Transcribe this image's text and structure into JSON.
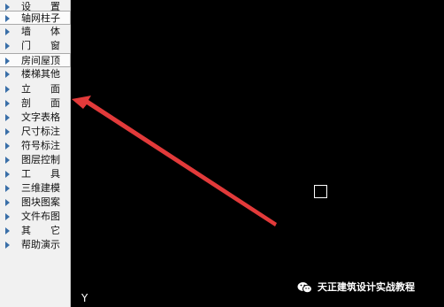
{
  "menu": {
    "items": [
      {
        "label": "设　　置",
        "name": "menu-item-settings"
      },
      {
        "label": "轴网柱子",
        "name": "menu-item-axis-grid-columns",
        "active": true
      },
      {
        "label": "墙　　体",
        "name": "menu-item-walls"
      },
      {
        "label": "门　　窗",
        "name": "menu-item-doors-windows"
      },
      {
        "label": "房间屋顶",
        "name": "menu-item-rooms-roof",
        "active": true
      },
      {
        "label": "楼梯其他",
        "name": "menu-item-stairs-other"
      },
      {
        "label": "立　　面",
        "name": "menu-item-elevation"
      },
      {
        "label": "剖　　面",
        "name": "menu-item-section"
      },
      {
        "label": "文字表格",
        "name": "menu-item-text-tables"
      },
      {
        "label": "尺寸标注",
        "name": "menu-item-dimensions"
      },
      {
        "label": "符号标注",
        "name": "menu-item-symbols"
      },
      {
        "label": "图层控制",
        "name": "menu-item-layer-control"
      },
      {
        "label": "工　　具",
        "name": "menu-item-tools"
      },
      {
        "label": "三维建模",
        "name": "menu-item-3d-modeling"
      },
      {
        "label": "图块图案",
        "name": "menu-item-blocks-patterns"
      },
      {
        "label": "文件布图",
        "name": "menu-item-file-layout"
      },
      {
        "label": "其　　它",
        "name": "menu-item-others"
      },
      {
        "label": "帮助演示",
        "name": "menu-item-help-demo"
      }
    ]
  },
  "canvas": {
    "axis_label": "Y",
    "annotation_arrow_color": "#e23a3a"
  },
  "watermark": {
    "icon": "wechat-icon",
    "text": "天正建筑设计实战教程"
  },
  "colors": {
    "background": "#000000",
    "menu_bg": "#f1f1f1",
    "menu_arrow": "#3a6fa8"
  }
}
